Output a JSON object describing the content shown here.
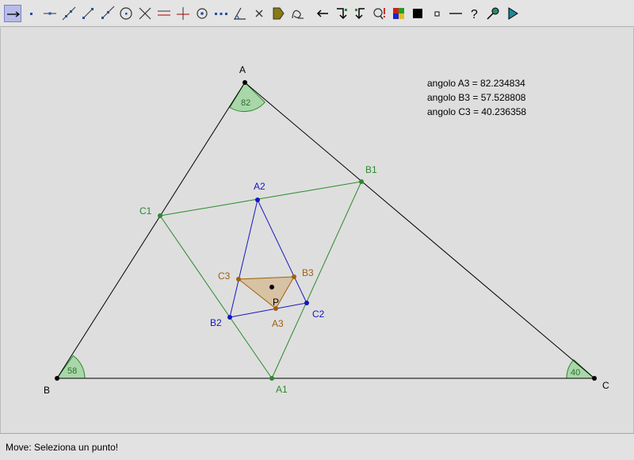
{
  "toolbar": {
    "tools": [
      {
        "name": "move-tool",
        "icon": "move-arrow-icon",
        "active": true
      },
      {
        "name": "point-tool",
        "icon": "point-icon"
      },
      {
        "name": "point-on-line-tool",
        "icon": "point-on-line-icon"
      },
      {
        "name": "line-tool",
        "icon": "line-icon"
      },
      {
        "name": "segment-tool",
        "icon": "segment-icon"
      },
      {
        "name": "ray-tool",
        "icon": "ray-icon"
      },
      {
        "name": "circle-tool",
        "icon": "circle-icon"
      },
      {
        "name": "intersect-tool",
        "icon": "intersect-icon"
      },
      {
        "name": "parallel-tool",
        "icon": "parallel-icon"
      },
      {
        "name": "perpendicular-tool",
        "icon": "perpendicular-icon"
      },
      {
        "name": "circle-center-tool",
        "icon": "circle-center-icon"
      },
      {
        "name": "polygon-tool",
        "icon": "dotted-line-icon"
      },
      {
        "name": "angle-tool",
        "icon": "angle-icon"
      },
      {
        "name": "delete-tool",
        "icon": "delete-x-icon"
      },
      {
        "name": "fill-tool",
        "icon": "fill-icon"
      },
      {
        "name": "locus-tool",
        "icon": "locus-icon"
      },
      {
        "name": "back-tool",
        "icon": "left-arrow-icon"
      },
      {
        "name": "step-forward-tool",
        "icon": "step-right-icon"
      },
      {
        "name": "step-back-tool",
        "icon": "step-left-icon"
      },
      {
        "name": "check-tool",
        "icon": "check-property-icon"
      },
      {
        "name": "color-tool",
        "icon": "color-palette-icon"
      },
      {
        "name": "thick-tool",
        "icon": "black-square-icon"
      },
      {
        "name": "point-style-tool",
        "icon": "small-square-icon"
      },
      {
        "name": "line-style-tool",
        "icon": "dash-line-icon"
      },
      {
        "name": "help-tool",
        "icon": "question-icon"
      },
      {
        "name": "measure-tool",
        "icon": "measure-icon"
      },
      {
        "name": "play-tool",
        "icon": "play-icon"
      }
    ]
  },
  "colors": {
    "black": "#000000",
    "green": "#2a8a2a",
    "blue": "#1616c0",
    "brown": "#a0600f",
    "angle_fill": "#a9d7a9"
  },
  "points": {
    "A": "A",
    "B": "B",
    "C": "C",
    "A1": "A1",
    "B1": "B1",
    "C1": "C1",
    "A2": "A2",
    "B2": "B2",
    "C2": "C2",
    "A3": "A3",
    "B3": "B3",
    "C3": "C3",
    "P": "P"
  },
  "angles": {
    "A": "82",
    "B": "58",
    "C": "40"
  },
  "info": {
    "angle_a3": "angolo A3 = 82.234834",
    "angle_b3": "angolo B3 = 57.528808",
    "angle_c3": "angolo C3 = 40.236358"
  },
  "status": {
    "text": "Move: Seleziona un punto!"
  }
}
